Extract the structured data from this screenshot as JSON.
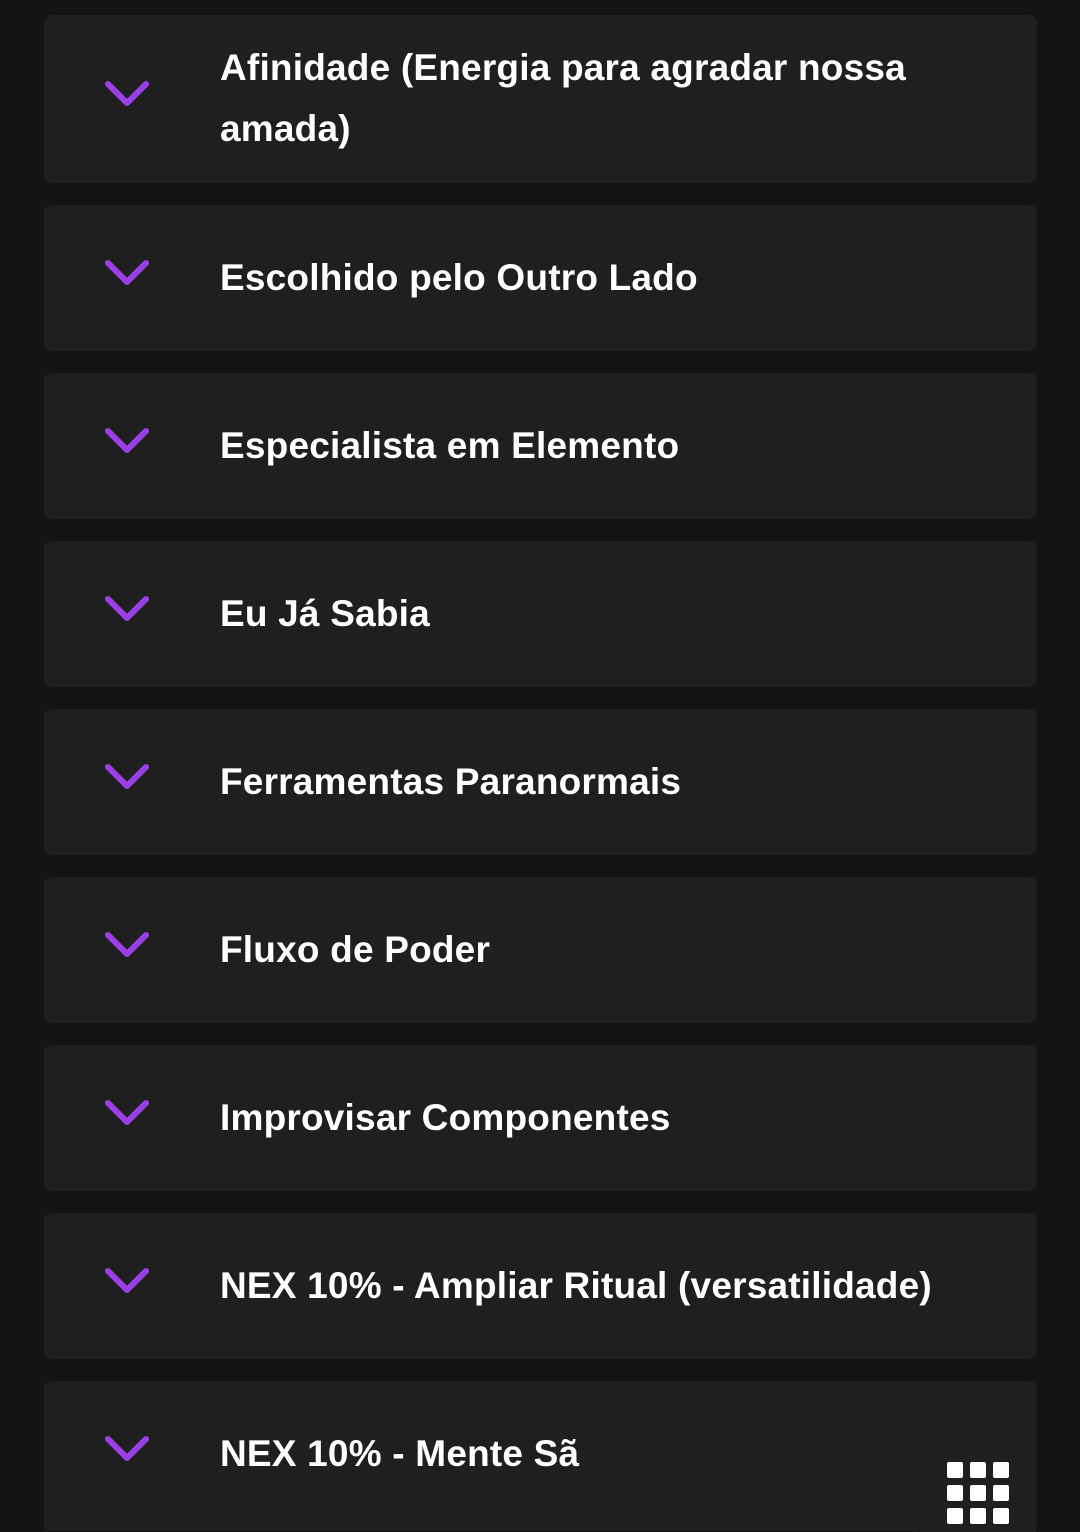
{
  "accent_color": "#9b3fe8",
  "items": [
    {
      "label": "Afinidade (Energia para agradar nossa amada)",
      "icon": "chevron-down-icon"
    },
    {
      "label": "Escolhido pelo Outro Lado",
      "icon": "chevron-down-icon"
    },
    {
      "label": "Especialista em Elemento",
      "icon": "chevron-down-icon"
    },
    {
      "label": "Eu Já Sabia",
      "icon": "chevron-down-icon"
    },
    {
      "label": "Ferramentas Paranormais",
      "icon": "chevron-down-icon"
    },
    {
      "label": "Fluxo de Poder",
      "icon": "chevron-down-icon"
    },
    {
      "label": "Improvisar Componentes",
      "icon": "chevron-down-icon"
    },
    {
      "label": "NEX 10% - Ampliar Ritual (versatilidade)",
      "icon": "chevron-down-icon"
    },
    {
      "label": "NEX 10% - Mente Sã",
      "icon": "chevron-down-icon"
    }
  ],
  "floating_button": {
    "icon": "grid-menu-icon"
  }
}
